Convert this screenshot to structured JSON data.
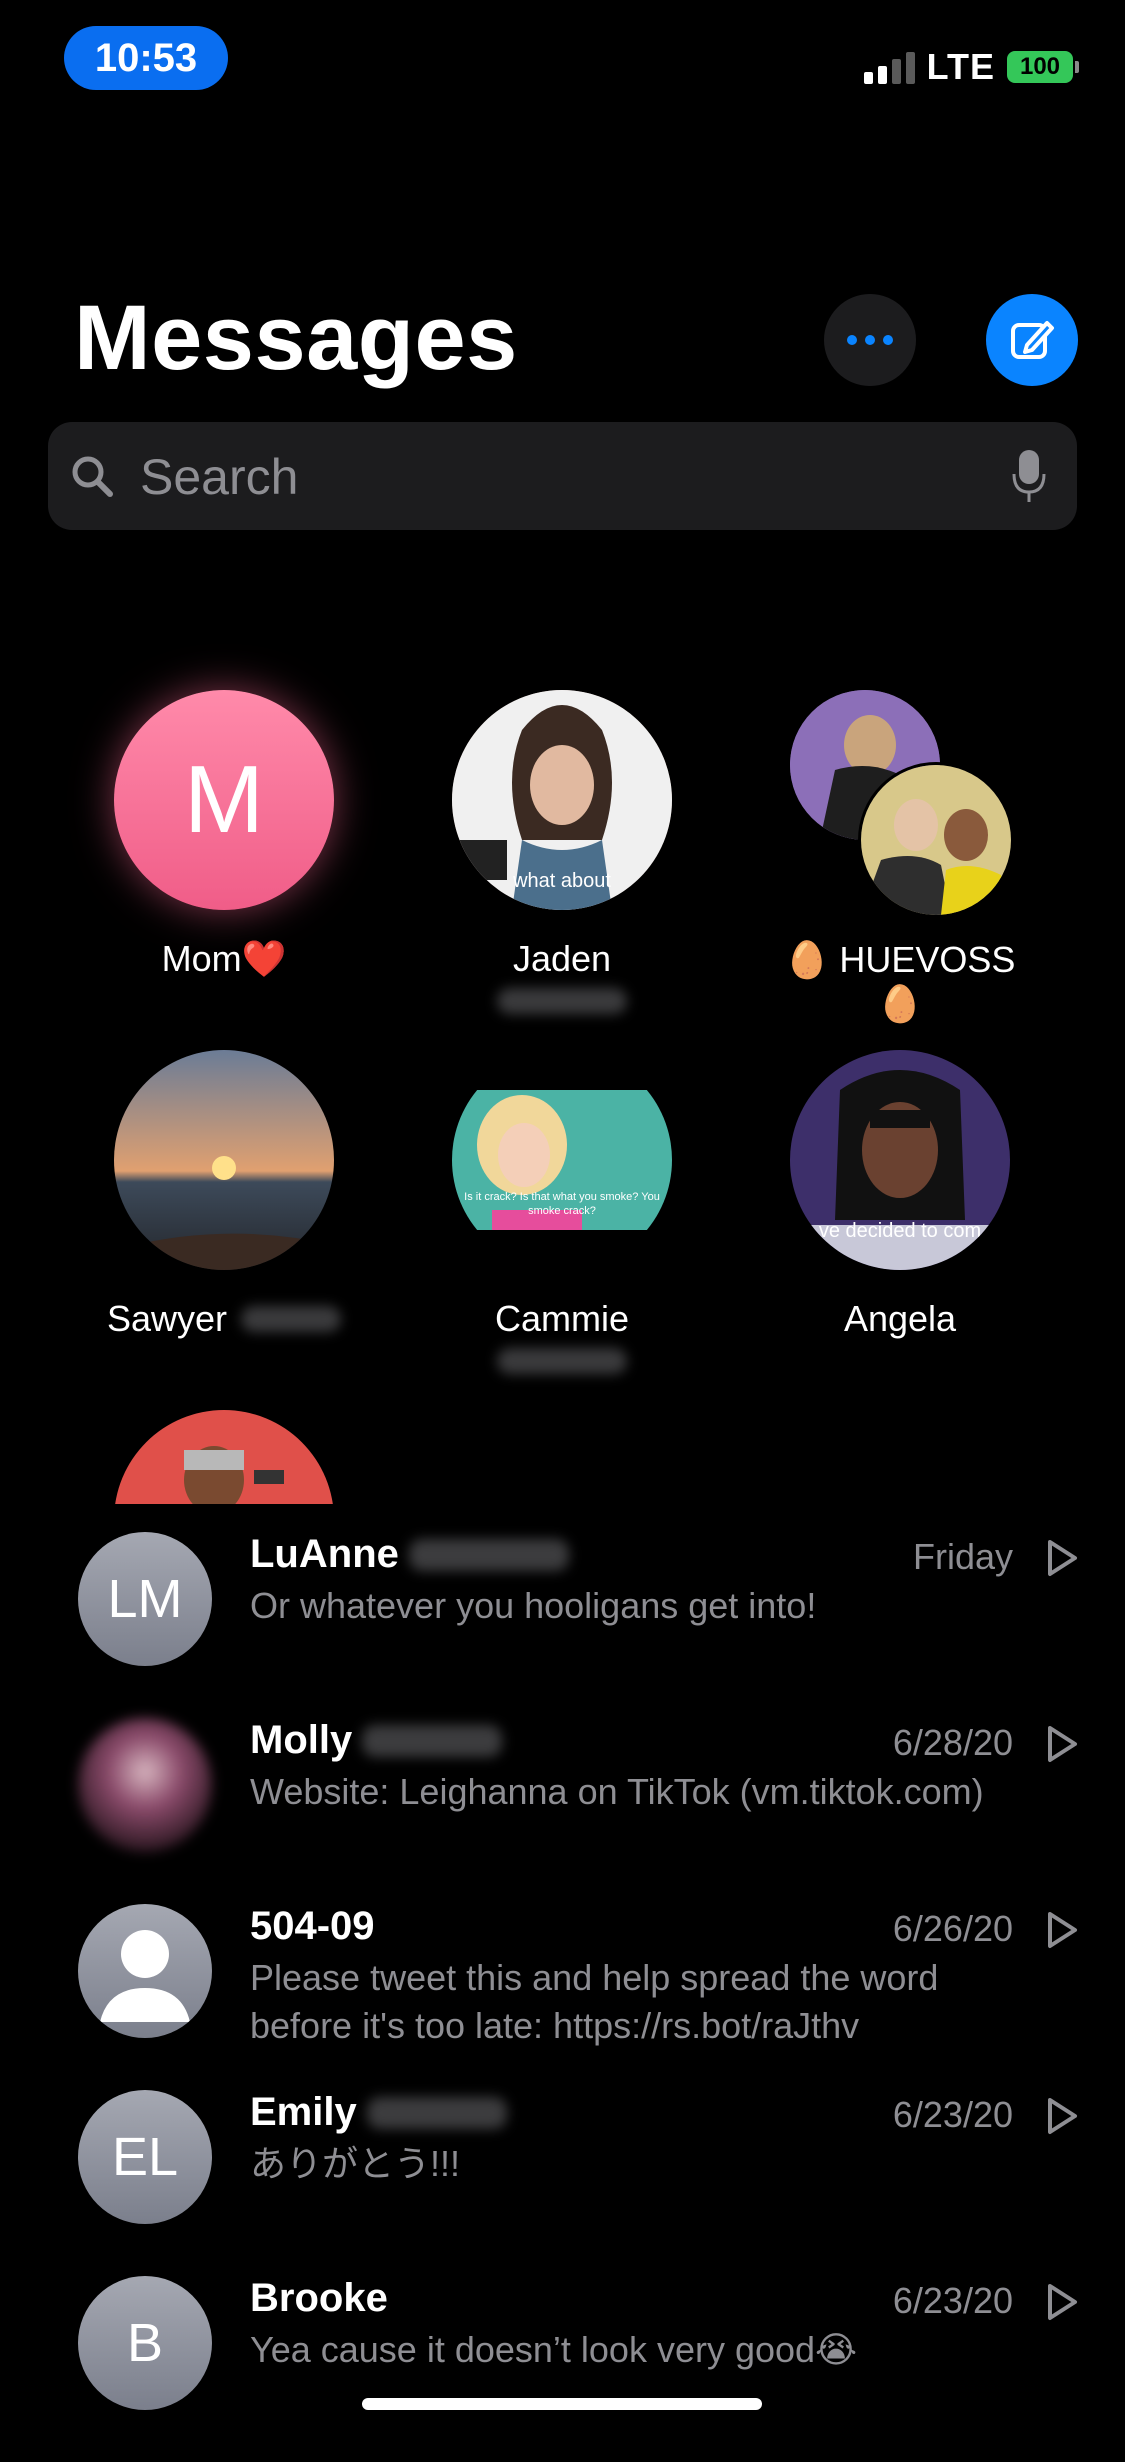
{
  "status_bar": {
    "time": "10:53",
    "network": "LTE",
    "battery": "100"
  },
  "header": {
    "title": "Messages"
  },
  "search": {
    "placeholder": "Search"
  },
  "pinned": [
    {
      "name": "Mom❤️",
      "initial": "M"
    },
    {
      "name": "Jaden",
      "avatar_overlay_text": "what about"
    },
    {
      "name": "🥚 HUEVOSS 🥚"
    },
    {
      "name": "Sawyer"
    },
    {
      "name": "Cammie",
      "avatar_overlay_text": "Is it crack? Is that what you smoke? You smoke crack?"
    },
    {
      "name": "Angela",
      "avatar_overlay_text": "ve  decided  to com"
    }
  ],
  "conversations": [
    {
      "initials": "LM",
      "name": "LuAnne",
      "date": "Friday",
      "preview": "Or whatever you hooligans get into!"
    },
    {
      "initials": "",
      "name": "Molly",
      "date": "6/28/20",
      "preview": "Website: Leighanna on TikTok (vm.tiktok.com)"
    },
    {
      "initials": "",
      "name": "504-09",
      "date": "6/26/20",
      "preview": "Please tweet this and help spread the word before it's too late: https://rs.bot/raJthv"
    },
    {
      "initials": "EL",
      "name": "Emily",
      "date": "6/23/20",
      "preview": "ありがとう!!!"
    },
    {
      "initials": "B",
      "name": "Brooke",
      "date": "6/23/20",
      "preview": "Yea cause it doesn’t look very good😭"
    }
  ],
  "colors": {
    "accent": "#0a84ff",
    "battery": "#34c759",
    "secondary_text": "#8e8e93"
  }
}
